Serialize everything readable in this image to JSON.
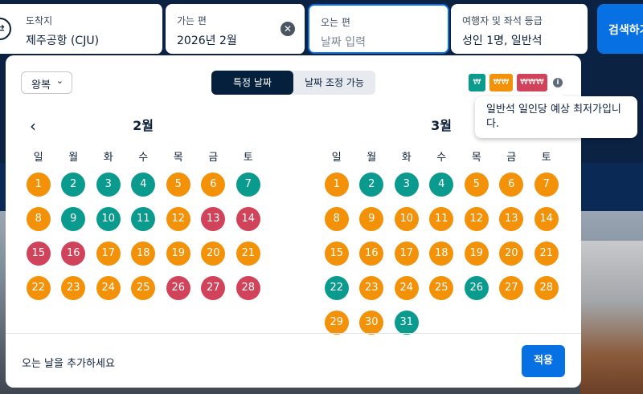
{
  "search": {
    "destination": {
      "label": "도착지",
      "value": "제주공항 (CJU)"
    },
    "depart": {
      "label": "가는 편",
      "value": "2026년 2월"
    },
    "return": {
      "label": "오는 편",
      "placeholder": "날짜 입력"
    },
    "travellers": {
      "label": "여행자 및 좌석 등급",
      "value": "성인 1명, 일반석"
    },
    "search_button": "검색하기",
    "swap_icon": "⇄",
    "clear_icon": "✕"
  },
  "panel": {
    "trip_type": "왕복",
    "mode_options": [
      "특정 날짜",
      "날짜 조정 가능"
    ],
    "legend": {
      "low": "₩",
      "mid": "₩₩",
      "high": "₩₩₩"
    },
    "legend_colors": {
      "low": "#0a9b8e",
      "mid": "#f39208",
      "high": "#d1435b"
    },
    "info_icon": "i",
    "tooltip": "일반석 일인당 예상 최저가입니다.",
    "prev_icon": "‹",
    "footer_hint": "오는 날을 추가하세요",
    "apply_button": "적용"
  },
  "calendar": {
    "weekdays": [
      "일",
      "월",
      "화",
      "수",
      "목",
      "금",
      "토"
    ],
    "months": [
      {
        "title": "2월",
        "start_offset": 0,
        "days": [
          "m",
          "l",
          "l",
          "l",
          "m",
          "m",
          "l",
          "m",
          "l",
          "l",
          "l",
          "m",
          "h",
          "h",
          "h",
          "h",
          "m",
          "m",
          "m",
          "m",
          "m",
          "m",
          "m",
          "m",
          "m",
          "h",
          "h",
          "h"
        ]
      },
      {
        "title": "3월",
        "start_offset": 0,
        "days": [
          "m",
          "l",
          "l",
          "l",
          "m",
          "m",
          "m",
          "m",
          "m",
          "m",
          "m",
          "m",
          "m",
          "m",
          "m",
          "m",
          "m",
          "m",
          "m",
          "m",
          "m",
          "l",
          "m",
          "m",
          "m",
          "l",
          "m",
          "m",
          "m",
          "m",
          "l"
        ]
      }
    ]
  }
}
